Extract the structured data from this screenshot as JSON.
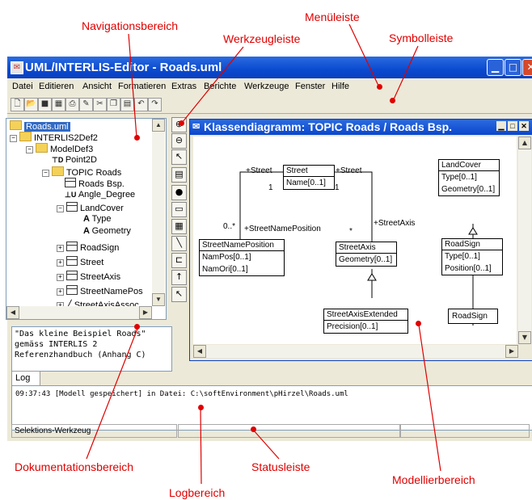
{
  "annotations": {
    "navigationsbereich": "Navigationsbereich",
    "menueleiste": "Menüleiste",
    "werkzeugleiste": "Werkzeugleiste",
    "symbolleiste": "Symbolleiste",
    "dokumentationsbereich": "Dokumentationsbereich",
    "statusleiste": "Statusleiste",
    "logbereich": "Logbereich",
    "modellierbereich": "Modellierbereich",
    "color": "#e00000"
  },
  "window": {
    "title": "UML/INTERLIS-Editor - Roads.uml",
    "min_icon": "minimize-icon",
    "max_icon": "maximize-icon",
    "close_icon": "close-icon"
  },
  "menu": [
    "Datei",
    "Editieren",
    "Ansicht",
    "Formatieren",
    "Extras",
    "Berichte",
    "Werkzeuge",
    "Fenster",
    "Hilfe"
  ],
  "symbolbar_icons": [
    "new-file-icon",
    "open-icon",
    "save-icon",
    "save-all-icon",
    "print-icon",
    "edit-icon",
    "cut-icon",
    "copy-icon",
    "paste-icon",
    "undo-icon",
    "redo-icon"
  ],
  "tree": [
    {
      "label": "Roads.uml",
      "icon": "folder-icon"
    },
    {
      "label": "INTERLIS2Def2",
      "icon": "folder-icon"
    },
    {
      "label": "ModelDef3",
      "icon": "folder-icon"
    },
    {
      "label": "Point2D",
      "icon": "domain-icon"
    },
    {
      "label": "TOPIC Roads",
      "icon": "folder-icon"
    },
    {
      "label": "Roads Bsp.",
      "icon": "diagram-icon"
    },
    {
      "label": "Angle_Degree",
      "icon": "unit-icon"
    },
    {
      "label": "LandCover",
      "icon": "class-icon"
    },
    {
      "label": "Type",
      "icon": "attribute-icon"
    },
    {
      "label": "Geometry",
      "icon": "attribute-icon"
    },
    {
      "label": "RoadSign",
      "icon": "class-icon"
    },
    {
      "label": "Street",
      "icon": "class-icon"
    },
    {
      "label": "StreetAxis",
      "icon": "class-icon"
    },
    {
      "label": "StreetNamePos",
      "icon": "class-icon"
    },
    {
      "label": "StreetAxisAssoc",
      "icon": "association-icon"
    }
  ],
  "documentation": [
    "\"Das kleine Beispiel Roads\"",
    "gemäss INTERLIS 2",
    "Referenzhandbuch (Anhang C)"
  ],
  "palette_icons": [
    "zoom-in-icon",
    "zoom-out-icon",
    "select-arrow-icon",
    "class-tool-icon",
    "domain-tool-icon",
    "package-tool-icon",
    "table-tool-icon",
    "line-tool-icon",
    "association-tool-icon",
    "generalization-tool-icon",
    "link-tool-icon"
  ],
  "diagram": {
    "title": "Klassendiagramm: TOPIC Roads / Roads Bsp.",
    "classes": {
      "street": {
        "name": "Street",
        "attrs": [
          "Name[0..1]"
        ]
      },
      "landcover": {
        "name": "LandCover",
        "attrs": [
          "Type[0..1]",
          "Geometry[0..1]"
        ]
      },
      "streetnameposition": {
        "name": "StreetNamePosition",
        "attrs": [
          "NamPos[0..1]",
          "NamOri[0..1]"
        ]
      },
      "streetaxis": {
        "name": "StreetAxis",
        "attrs": [
          "Geometry[0..1]"
        ]
      },
      "roadsign": {
        "name": "RoadSign",
        "attrs": [
          "Type[0..1]",
          "Position[0..1]"
        ]
      },
      "streetaxisextended": {
        "name": "StreetAxisExtended",
        "attrs": [
          "Precision[0..1]"
        ]
      },
      "roadsign_sub": {
        "name": "RoadSign",
        "attrs": []
      }
    },
    "labels": {
      "street_left": "+Street",
      "street_right": "+Street",
      "mult_one_left": "1",
      "mult_one_right": "1",
      "mult_many_left": "0..*",
      "mult_many_right": "*",
      "role_namepos": "+StreetNamePosition",
      "role_axis": "+StreetAxis"
    }
  },
  "log": {
    "tab": "Log",
    "text": "09:37:43 [Modell gespeichert] in Datei: C:\\softEnvironment\\pHirzel\\Roads.uml"
  },
  "status": {
    "text": "Selektions-Werkzeug"
  }
}
